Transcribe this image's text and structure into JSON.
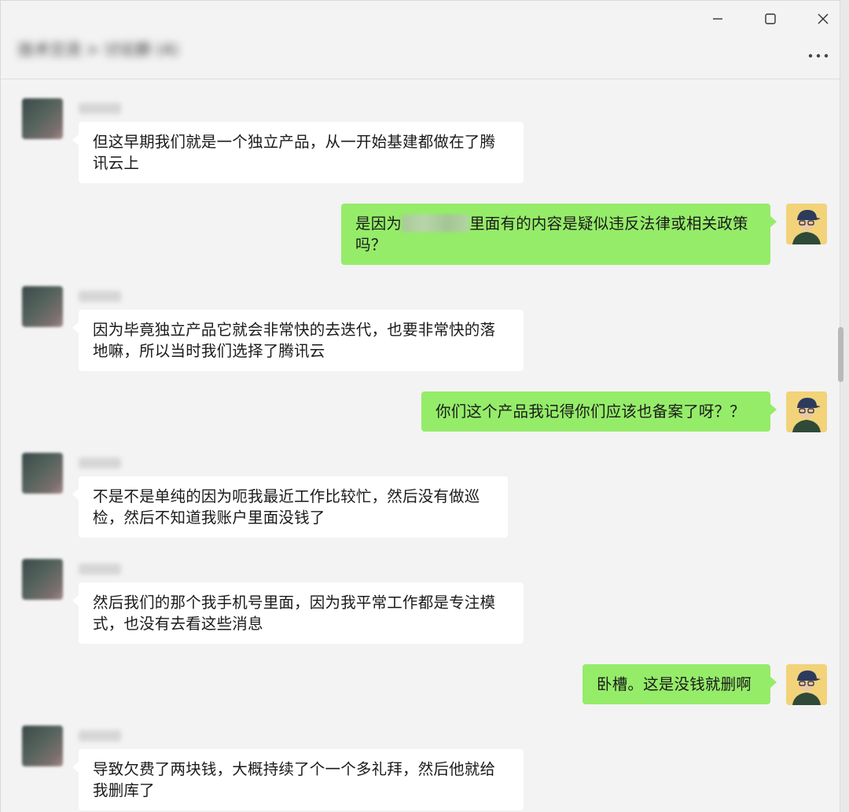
{
  "window": {
    "title": "技术交流 > 讨论群 (4)",
    "controls": {
      "minimize": "minimize-icon",
      "maximize": "maximize-icon",
      "close": "close-icon",
      "more": "more-icon"
    }
  },
  "colors": {
    "my_bubble": "#95ec69",
    "other_bubble": "#ffffff",
    "background": "#f3f3f3"
  },
  "messages": [
    {
      "from": "other",
      "lines": [
        "但这早期我们就是一个独立产品，从一开始基建都做在了腾",
        "讯云上"
      ]
    },
    {
      "from": "me",
      "line1_before": "是因为",
      "line1_after": "里面有的内容是疑似违反法律或相关政策",
      "line2": "吗？"
    },
    {
      "from": "other",
      "lines": [
        "因为毕竟独立产品它就会非常快的去迭代，也要非常快的落",
        "地嘛，所以当时我们选择了腾讯云"
      ]
    },
    {
      "from": "me",
      "lines": [
        "你们这个产品我记得你们应该也备案了呀？？"
      ]
    },
    {
      "from": "other",
      "lines": [
        "不是不是单纯的因为呃我最近工作比较忙，然后没有做巡",
        "检，然后不知道我账户里面没钱了"
      ]
    },
    {
      "from": "other",
      "lines": [
        "然后我们的那个我手机号里面，因为我平常工作都是专注模",
        "式，也没有去看这些消息"
      ]
    },
    {
      "from": "me",
      "lines": [
        "卧槽。这是没钱就删啊"
      ]
    },
    {
      "from": "other",
      "lines": [
        "导致欠费了两块钱，大概持续了个一个多礼拜，然后他就给",
        "我删库了"
      ]
    }
  ]
}
